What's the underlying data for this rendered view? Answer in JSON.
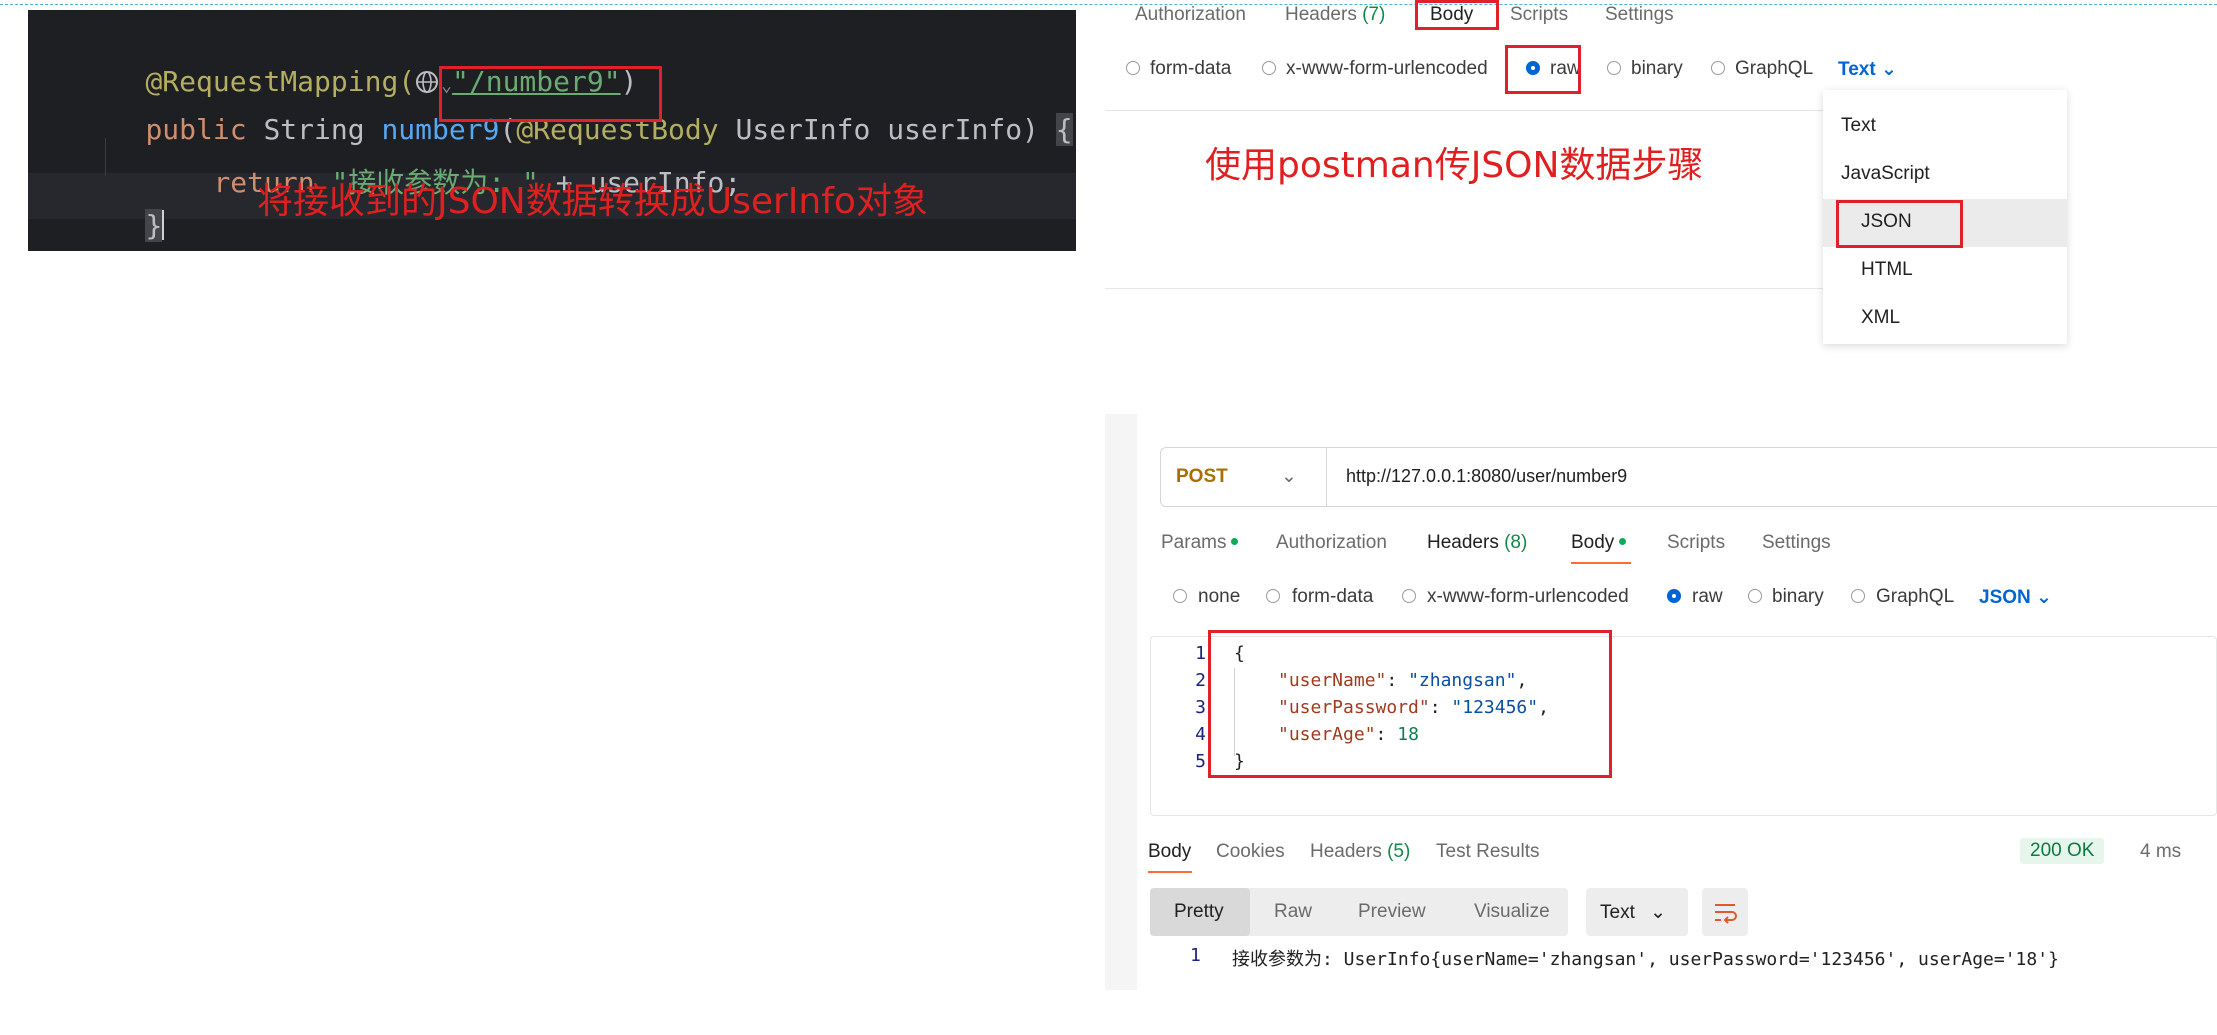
{
  "code": {
    "line1_anno": "@RequestMapping(",
    "line1_url": "\"/number9\"",
    "line1_close": ")",
    "line2_public": "public",
    "line2_type": " String ",
    "line2_fn": "number9",
    "line2_paren": "(",
    "line2_anno": "@RequestBody",
    "line2_rest": " UserInfo userInfo) ",
    "line2_brace": "{",
    "line3_return": "return",
    "line3_str": "\"接收参数为: \"",
    "line3_rest": " + userInfo;",
    "line4_brace": "}",
    "note": "将接收到的JSON数据转换成UserInfo对象"
  },
  "top_panel": {
    "tabs": [
      "Authorization",
      "Headers",
      "Body",
      "Scripts",
      "Settings"
    ],
    "headers_count": "(7)",
    "options": [
      "form-data",
      "x-www-form-urlencoded",
      "raw",
      "binary",
      "GraphQL"
    ],
    "format": "Text",
    "annotation": "使用postman传JSON数据步骤",
    "dropdown_items": [
      "Text",
      "JavaScript",
      "JSON",
      "HTML",
      "XML"
    ]
  },
  "request": {
    "method": "POST",
    "url": "http://127.0.0.1:8080/user/number9",
    "tabs": {
      "params": "Params",
      "authorization": "Authorization",
      "headers": "Headers",
      "headers_count": "(8)",
      "body": "Body",
      "scripts": "Scripts",
      "settings": "Settings"
    },
    "body_options": [
      "none",
      "form-data",
      "x-www-form-urlencoded",
      "raw",
      "binary",
      "GraphQL"
    ],
    "body_format": "JSON",
    "line_numbers": [
      "1",
      "2",
      "3",
      "4",
      "5"
    ],
    "json": {
      "open": "{",
      "k1": "\"userName\"",
      "v1": "\"zhangsan\"",
      "k2": "\"userPassword\"",
      "v2": "\"123456\"",
      "k3": "\"userAge\"",
      "v3": "18",
      "close": "}"
    }
  },
  "response": {
    "tabs": {
      "body": "Body",
      "cookies": "Cookies",
      "headers": "Headers",
      "headers_count": "(5)",
      "test_results": "Test Results"
    },
    "status": "200 OK",
    "time": "4 ms",
    "view_tabs": [
      "Pretty",
      "Raw",
      "Preview",
      "Visualize"
    ],
    "format": "Text",
    "line_number": "1",
    "output": "接收参数为: UserInfo{userName='zhangsan', userPassword='123456', userAge='18'}"
  },
  "colors": {
    "annotation_red": "#e02020",
    "postman_blue": "#0265d2",
    "postman_orange": "#ff6c37",
    "code_bg": "#1e1f22"
  }
}
